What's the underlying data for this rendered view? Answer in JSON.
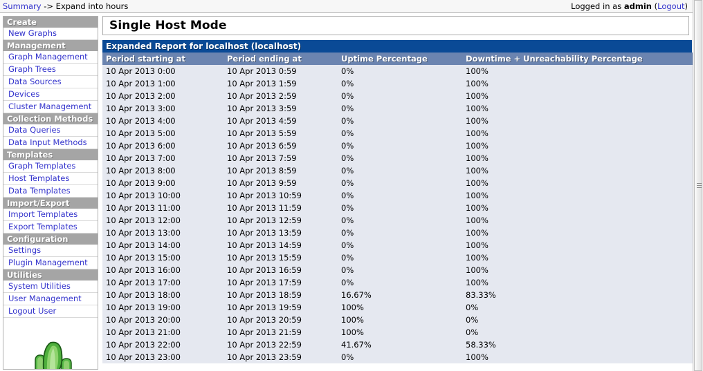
{
  "topbar": {
    "breadcrumb_link": "Summary",
    "breadcrumb_rest": " -> Expand into hours",
    "logged_in_prefix": "Logged in as ",
    "username": "admin",
    "logout_open": " (",
    "logout_label": "Logout",
    "logout_close": ")"
  },
  "sidebar": {
    "sections": [
      {
        "header": "Create",
        "items": [
          "New Graphs"
        ]
      },
      {
        "header": "Management",
        "items": [
          "Graph Management",
          "Graph Trees",
          "Data Sources",
          "Devices",
          "Cluster Management"
        ]
      },
      {
        "header": "Collection Methods",
        "items": [
          "Data Queries",
          "Data Input Methods"
        ]
      },
      {
        "header": "Templates",
        "items": [
          "Graph Templates",
          "Host Templates",
          "Data Templates"
        ]
      },
      {
        "header": "Import/Export",
        "items": [
          "Import Templates",
          "Export Templates"
        ]
      },
      {
        "header": "Configuration",
        "items": [
          "Settings",
          "Plugin Management"
        ]
      },
      {
        "header": "Utilities",
        "items": [
          "System Utilities",
          "User Management",
          "Logout User"
        ]
      }
    ],
    "logo_name": "cacti-cactus-logo"
  },
  "content": {
    "page_title": "Single Host Mode",
    "report_title": "Expanded Report for localhost (localhost)",
    "columns": [
      "Period starting at",
      "Period ending at",
      "Uptime Percentage",
      "Downtime + Unreachability Percentage"
    ],
    "rows": [
      [
        "10 Apr 2013 0:00",
        "10 Apr 2013 0:59",
        "0%",
        "100%"
      ],
      [
        "10 Apr 2013 1:00",
        "10 Apr 2013 1:59",
        "0%",
        "100%"
      ],
      [
        "10 Apr 2013 2:00",
        "10 Apr 2013 2:59",
        "0%",
        "100%"
      ],
      [
        "10 Apr 2013 3:00",
        "10 Apr 2013 3:59",
        "0%",
        "100%"
      ],
      [
        "10 Apr 2013 4:00",
        "10 Apr 2013 4:59",
        "0%",
        "100%"
      ],
      [
        "10 Apr 2013 5:00",
        "10 Apr 2013 5:59",
        "0%",
        "100%"
      ],
      [
        "10 Apr 2013 6:00",
        "10 Apr 2013 6:59",
        "0%",
        "100%"
      ],
      [
        "10 Apr 2013 7:00",
        "10 Apr 2013 7:59",
        "0%",
        "100%"
      ],
      [
        "10 Apr 2013 8:00",
        "10 Apr 2013 8:59",
        "0%",
        "100%"
      ],
      [
        "10 Apr 2013 9:00",
        "10 Apr 2013 9:59",
        "0%",
        "100%"
      ],
      [
        "10 Apr 2013 10:00",
        "10 Apr 2013 10:59",
        "0%",
        "100%"
      ],
      [
        "10 Apr 2013 11:00",
        "10 Apr 2013 11:59",
        "0%",
        "100%"
      ],
      [
        "10 Apr 2013 12:00",
        "10 Apr 2013 12:59",
        "0%",
        "100%"
      ],
      [
        "10 Apr 2013 13:00",
        "10 Apr 2013 13:59",
        "0%",
        "100%"
      ],
      [
        "10 Apr 2013 14:00",
        "10 Apr 2013 14:59",
        "0%",
        "100%"
      ],
      [
        "10 Apr 2013 15:00",
        "10 Apr 2013 15:59",
        "0%",
        "100%"
      ],
      [
        "10 Apr 2013 16:00",
        "10 Apr 2013 16:59",
        "0%",
        "100%"
      ],
      [
        "10 Apr 2013 17:00",
        "10 Apr 2013 17:59",
        "0%",
        "100%"
      ],
      [
        "10 Apr 2013 18:00",
        "10 Apr 2013 18:59",
        "16.67%",
        "83.33%"
      ],
      [
        "10 Apr 2013 19:00",
        "10 Apr 2013 19:59",
        "100%",
        "0%"
      ],
      [
        "10 Apr 2013 20:00",
        "10 Apr 2013 20:59",
        "100%",
        "0%"
      ],
      [
        "10 Apr 2013 21:00",
        "10 Apr 2013 21:59",
        "100%",
        "0%"
      ],
      [
        "10 Apr 2013 22:00",
        "10 Apr 2013 22:59",
        "41.67%",
        "58.33%"
      ],
      [
        "10 Apr 2013 23:00",
        "10 Apr 2013 23:59",
        "0%",
        "100%"
      ]
    ]
  },
  "colors": {
    "report_title_bg": "#0A4A96",
    "column_header_bg": "#6B84B0",
    "row_bg": "#E5E8F0",
    "section_header_bg": "#A5A5A5",
    "link": "#3333CC"
  },
  "scrollbar": {
    "name": "vertical-scrollbar"
  }
}
